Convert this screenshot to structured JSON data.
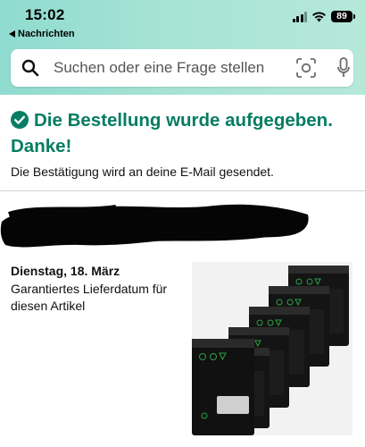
{
  "status_bar": {
    "time": "15:02",
    "back_label": "Nachrichten",
    "battery": "89"
  },
  "search": {
    "placeholder": "Suchen oder eine Frage stellen"
  },
  "confirmation": {
    "title": "Die Bestellung wurde aufgegeben. Danke!",
    "subtitle": "Die Bestätigung wird an deine E-Mail gesendet.",
    "accent_color": "#067d62"
  },
  "delivery": {
    "date": "Dienstag, 18. März",
    "note": "Garantiertes Lieferdatum für diesen Artikel"
  },
  "icons": {
    "search": "magnifier-icon",
    "lens": "camera-lens-icon",
    "mic": "microphone-icon",
    "check": "check-circle-icon"
  }
}
